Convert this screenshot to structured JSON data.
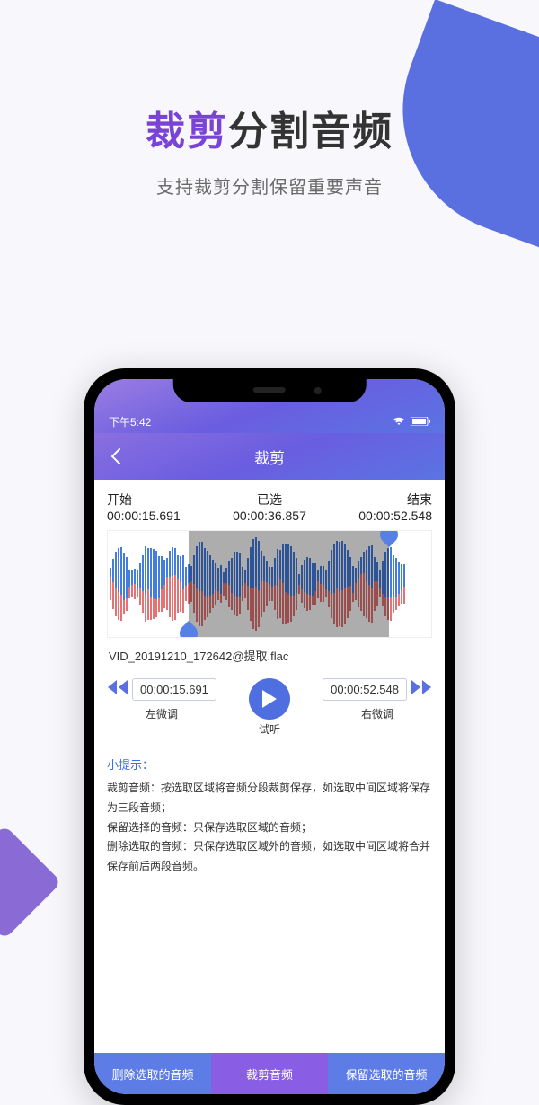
{
  "marketing": {
    "headline_accent": "裁剪",
    "headline_rest": "分割音频",
    "subtitle": "支持裁剪分割保留重要声音"
  },
  "status": {
    "time": "下午5:42"
  },
  "nav": {
    "title": "裁剪"
  },
  "times": {
    "start_label": "开始",
    "start_value": "00:00:15.691",
    "selected_label": "已选",
    "selected_value": "00:00:36.857",
    "end_label": "结束",
    "end_value": "00:00:52.548"
  },
  "file": {
    "name": "VID_20191210_172642@提取.flac"
  },
  "controls": {
    "left_time": "00:00:15.691",
    "left_label": "左微调",
    "play_label": "试听",
    "right_time": "00:00:52.548",
    "right_label": "右微调"
  },
  "tips": {
    "title": "小提示：",
    "line1": "裁剪音频：按选取区域将音频分段裁剪保存，如选取中间区域将保存为三段音频；",
    "line2": "保留选择的音频：只保存选取区域的音频；",
    "line3": "删除选取的音频：只保存选取区域外的音频，如选取中间区域将合并保存前后两段音频。"
  },
  "bottom": {
    "delete": "删除选取的音频",
    "crop": "裁剪音频",
    "keep": "保留选取的音频"
  }
}
